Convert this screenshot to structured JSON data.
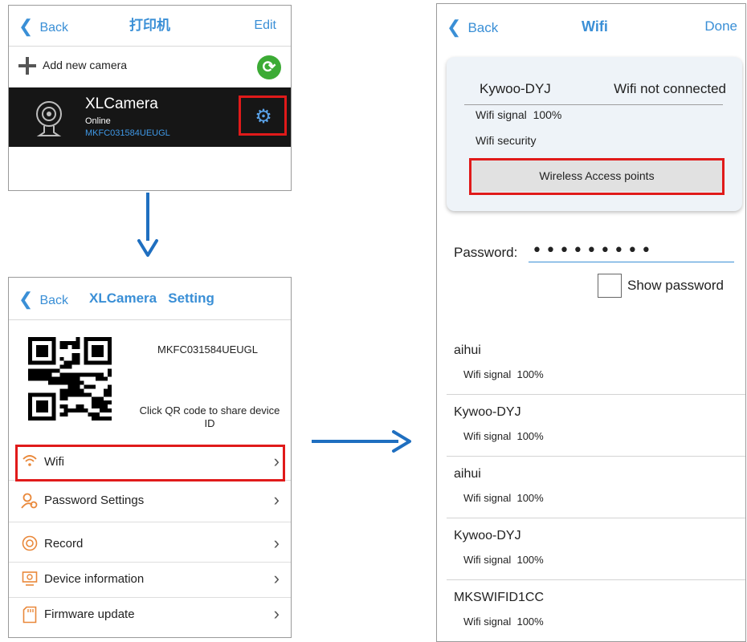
{
  "colors": {
    "accent": "#3a8fd6",
    "highlight": "#e01a1a",
    "arrow": "#1f6fc0",
    "camera_bar": "#161616",
    "refresh_green": "#3cab35"
  },
  "panel1": {
    "back": "Back",
    "title": "打印机",
    "edit": "Edit",
    "add_label": "Add new camera",
    "refresh_icon": "refresh-icon",
    "camera": {
      "name": "XLCamera",
      "status": "Online",
      "id": "MKFC031584UEUGL"
    },
    "gear_icon": "gear-icon"
  },
  "panel2": {
    "back": "Back",
    "title": "XLCamera   Setting",
    "device_id": "MKFC031584UEUGL",
    "qr_hint": "Click QR code to share device ID",
    "menu": [
      {
        "label": "Wifi",
        "icon": "wifi-icon"
      },
      {
        "label": "Password Settings",
        "icon": "user-key-icon"
      },
      {
        "label": "Record",
        "icon": "record-icon"
      },
      {
        "label": "Device information",
        "icon": "monitor-icon"
      },
      {
        "label": "Firmware update",
        "icon": "sd-card-icon"
      }
    ]
  },
  "panel3": {
    "back": "Back",
    "title": "Wifi",
    "done": "Done",
    "card": {
      "ssid": "Kywoo-DYJ",
      "status": "Wifi not connected",
      "signal": "Wifi signal  100%",
      "security": "Wifi security",
      "button": "Wireless Access points"
    },
    "password_label": "Password:",
    "password_value": "•••••••••",
    "show_password": "Show password",
    "access_points": [
      {
        "ssid": "aihui",
        "signal": "Wifi signal  100%"
      },
      {
        "ssid": "Kywoo-DYJ",
        "signal": "Wifi signal  100%"
      },
      {
        "ssid": "aihui",
        "signal": "Wifi signal  100%"
      },
      {
        "ssid": "Kywoo-DYJ",
        "signal": "Wifi signal  100%"
      },
      {
        "ssid": "MKSWIFID1CC",
        "signal": "Wifi signal  100%"
      }
    ]
  }
}
